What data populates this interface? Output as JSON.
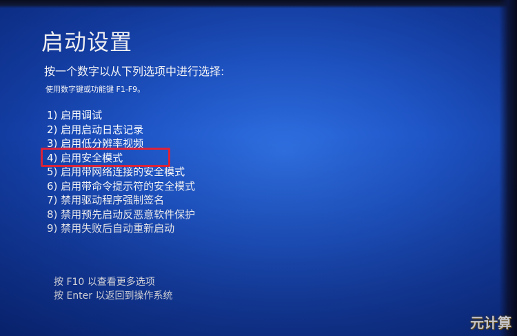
{
  "screen": {
    "title": "启动设置",
    "instruction": "按一个数字以从下列选项中进行选择:",
    "sub_instruction": "使用数字键或功能键 F1-F9。",
    "options": [
      "1) 启用调试",
      "2) 启用启动日志记录",
      "3) 启用低分辨率视频",
      "4) 启用安全模式",
      "5) 启用带网络连接的安全模式",
      "6) 启用带命令提示符的安全模式",
      "7) 禁用驱动程序强制签名",
      "8) 禁用预先启动反恶意软件保护",
      "9) 禁用失败后自动重新启动"
    ],
    "highlighted_option": "4) 启用安全模式",
    "highlight_color": "#e0243a",
    "footer": {
      "more_options": "按 F10 以查看更多选项",
      "return_os": "按 Enter 以返回到操作系统"
    }
  },
  "watermark": {
    "text": "元计算"
  },
  "colors": {
    "background": "#1f56c8",
    "text": "#ffffff"
  }
}
